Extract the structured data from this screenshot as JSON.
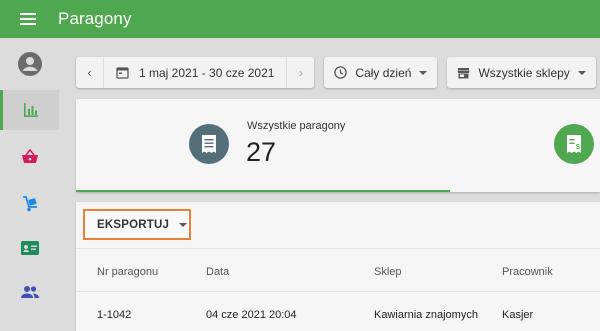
{
  "app": {
    "title": "Paragony"
  },
  "filters": {
    "date_range": "1 maj 2021 - 30 cze 2021",
    "time_range": "Cały dzień",
    "stores": "Wszystkie sklepy"
  },
  "stats": {
    "all_receipts_label": "Wszystkie paragony",
    "all_receipts_value": "27"
  },
  "table": {
    "export_label": "EKSPORTUJ",
    "columns": [
      "Nr paragonu",
      "Data",
      "Sklep",
      "Pracownik"
    ],
    "rows": [
      [
        "1-1042",
        "04 cze 2021 20:04",
        "Kawiarnia znajomych",
        "Kasjer"
      ]
    ]
  },
  "colors": {
    "brand": "#4fa84f",
    "highlight": "#e8823a"
  }
}
